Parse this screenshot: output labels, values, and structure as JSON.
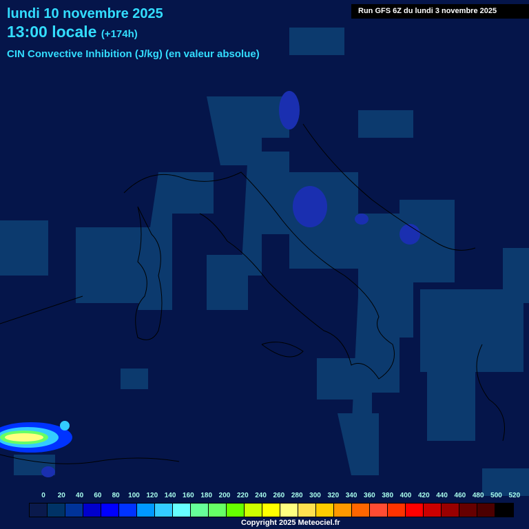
{
  "header": {
    "date": "lundi 10 novembre 2025",
    "time": "13:00 locale",
    "offset": "(+174h)",
    "parameter": "CIN Convective Inhibition (J/kg) (en valeur absolue)",
    "run": "Run GFS 6Z du lundi 3 novembre 2025"
  },
  "legend": {
    "labels": [
      "0",
      "20",
      "40",
      "60",
      "80",
      "100",
      "120",
      "140",
      "160",
      "180",
      "200",
      "220",
      "240",
      "260",
      "280",
      "300",
      "320",
      "340",
      "360",
      "380",
      "400",
      "420",
      "440",
      "460",
      "480",
      "500",
      "520"
    ],
    "colors": [
      "#0a1a4c",
      "#003366",
      "#003399",
      "#0000cc",
      "#0000ff",
      "#0033ff",
      "#0099ff",
      "#33ccff",
      "#66ffff",
      "#66ff99",
      "#66ff66",
      "#66ff00",
      "#ccff00",
      "#ffff00",
      "#ffff80",
      "#ffe050",
      "#ffcc00",
      "#ff9900",
      "#ff6600",
      "#ff4c33",
      "#ff3300",
      "#ff0000",
      "#cc0000",
      "#990000",
      "#660000",
      "#4c0000",
      "#000000"
    ]
  },
  "colors": {
    "background": "#05154a",
    "low": "#0c3a6e",
    "mid": "#1a2fb0"
  },
  "copyright": "Copyright 2025 Meteociel.fr"
}
